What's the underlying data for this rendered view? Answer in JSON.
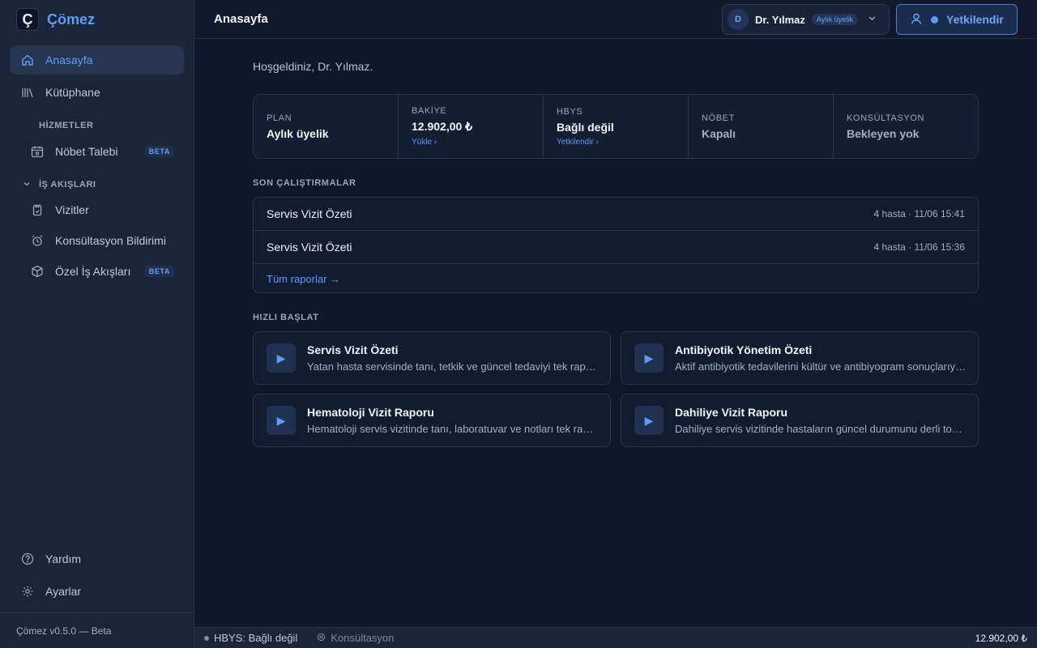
{
  "app": {
    "logo_letter": "Ç",
    "name": "Çömez",
    "version": "Çömez v0.5.0 — Beta"
  },
  "sidebar": {
    "home": "Anasayfa",
    "library": "Kütüphane",
    "services_label": "HİZMETLER",
    "duty_request": "Nöbet Talebi",
    "workflows_label": "İŞ AKIŞLARI",
    "visits": "Vizitler",
    "consult": "Konsültasyon Bildirimi",
    "custom_flows": "Özel İş Akışları",
    "beta": "BETA",
    "help": "Yardım",
    "settings": "Ayarlar"
  },
  "header": {
    "title": "Anasayfa",
    "avatar_letter": "D",
    "user_name": "Dr. Yılmaz",
    "plan_badge": "Aylık üyelik",
    "authorize_button": "Yetkilendir"
  },
  "main": {
    "welcome": "Hoşgeldiniz, Dr. Yılmaz.",
    "stats": [
      {
        "label": "PLAN",
        "value": "Aylık üyelik",
        "link": ""
      },
      {
        "label": "BAKİYE",
        "value": "12.902,00 ₺",
        "link": "Yükle ›"
      },
      {
        "label": "HBYS",
        "value": "Bağlı değil",
        "link": "Yetkilendir ›"
      },
      {
        "label": "NÖBET",
        "value": "Kapalı",
        "link": ""
      },
      {
        "label": "KONSÜLTASYON",
        "value": "Bekleyen yok",
        "link": ""
      }
    ],
    "recent_label": "SON ÇALIŞTIRMALAR",
    "recent_runs": [
      {
        "name": "Servis Vizit Özeti",
        "meta": "4 hasta · 11/06 15:41"
      },
      {
        "name": "Servis Vizit Özeti",
        "meta": "4 hasta · 11/06 15:36"
      }
    ],
    "all_reports": "Tüm raporlar →",
    "quick_label": "HIZLI BAŞLAT",
    "quick_start": [
      {
        "title": "Servis Vizit Özeti",
        "desc": "Yatan hasta servisinde tanı, tetkik ve güncel tedaviyi tek rapor halinde özetler."
      },
      {
        "title": "Antibiyotik Yönetim Özeti",
        "desc": "Aktif antibiyotik tedavilerini kültür ve antibiyogram sonuçlarıyla birlikte özetler."
      },
      {
        "title": "Hematoloji Vizit Raporu",
        "desc": "Hematoloji servis vizitinde tanı, laboratuvar ve notları tek rapor halinde sunar."
      },
      {
        "title": "Dahiliye Vizit Raporu",
        "desc": "Dahiliye servis vizitinde hastaların güncel durumunu derli toplu özetler."
      }
    ]
  },
  "statusbar": {
    "hbys": "HBYS: Bağlı değil",
    "consult": "Konsültasyon",
    "balance": "12.902,00 ₺"
  },
  "colors": {
    "accent": "#5b9cf5",
    "background": "#0f1829",
    "sidebar": "#1a2539"
  }
}
